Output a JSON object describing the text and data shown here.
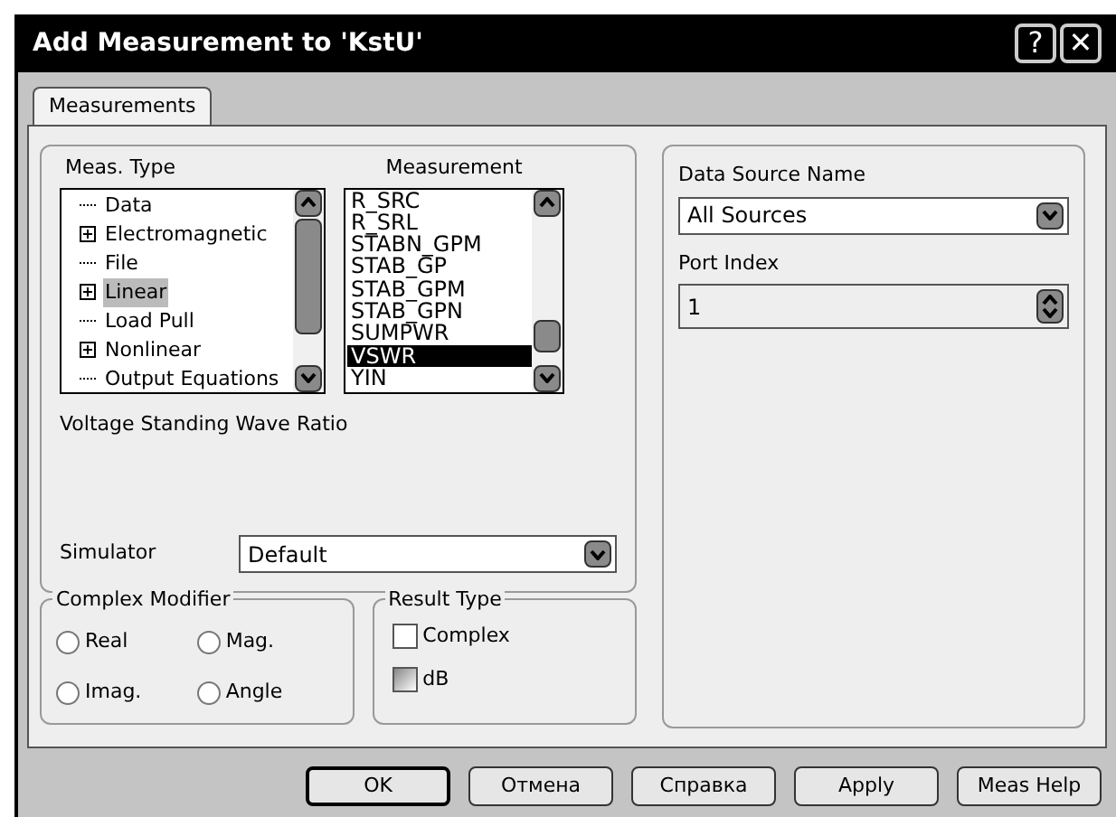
{
  "window": {
    "title": "Add Measurement to 'KstU'",
    "buttons": [
      "?",
      "✕"
    ]
  },
  "tabs": [
    {
      "label": "Measurements",
      "selected": true
    }
  ],
  "meas_type": {
    "label": "Meas. Type",
    "items": [
      {
        "label": "Data",
        "expandable": false,
        "selected": false
      },
      {
        "label": "Electromagnetic",
        "expandable": true,
        "selected": false
      },
      {
        "label": "File",
        "expandable": false,
        "selected": false
      },
      {
        "label": "Linear",
        "expandable": true,
        "selected": true
      },
      {
        "label": "Load Pull",
        "expandable": false,
        "selected": false
      },
      {
        "label": "Nonlinear",
        "expandable": true,
        "selected": false
      },
      {
        "label": "Output Equations",
        "expandable": false,
        "selected": false
      }
    ]
  },
  "measurement": {
    "label": "Measurement",
    "items": [
      {
        "label": "R_SRC",
        "selected": false
      },
      {
        "label": "R_SRL",
        "selected": false
      },
      {
        "label": "STABN_GPM",
        "selected": false
      },
      {
        "label": "STAB_GP",
        "selected": false
      },
      {
        "label": "STAB_GPM",
        "selected": false
      },
      {
        "label": "STAB_GPN",
        "selected": false
      },
      {
        "label": "SUMPWR",
        "selected": false
      },
      {
        "label": "VSWR",
        "selected": true
      },
      {
        "label": "YIN",
        "selected": false
      }
    ]
  },
  "description": "Voltage Standing Wave Ratio",
  "simulator": {
    "label": "Simulator",
    "value": "Default"
  },
  "complex_modifier": {
    "label": "Complex Modifier",
    "options": [
      {
        "label": "Real",
        "selected": false
      },
      {
        "label": "Mag.",
        "selected": false
      },
      {
        "label": "Imag.",
        "selected": false
      },
      {
        "label": "Angle",
        "selected": false
      }
    ]
  },
  "result_type": {
    "label": "Result Type",
    "options": [
      {
        "label": "Complex",
        "checked": false,
        "disabled": false
      },
      {
        "label": "dB",
        "checked": false,
        "disabled": true
      }
    ]
  },
  "data_source": {
    "label": "Data Source Name",
    "value": "All Sources"
  },
  "port_index": {
    "label": "Port Index",
    "value": "1"
  },
  "buttons": [
    {
      "label": "OK",
      "default": true
    },
    {
      "label": "Отмена",
      "default": false
    },
    {
      "label": "Справка",
      "default": false
    },
    {
      "label": "Apply",
      "default": false
    },
    {
      "label": "Meas Help",
      "default": false
    }
  ]
}
